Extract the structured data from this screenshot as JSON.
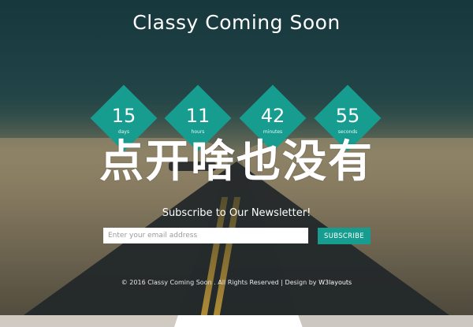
{
  "page": {
    "title": "Classy Coming Soon"
  },
  "countdown": [
    {
      "value": "15",
      "label": "days"
    },
    {
      "value": "11",
      "label": "hours"
    },
    {
      "value": "42",
      "label": "minutes"
    },
    {
      "value": "55",
      "label": "seconds"
    }
  ],
  "overlay": {
    "text": "点开啥也没有"
  },
  "newsletter": {
    "title": "Subscribe to Our Newsletter!",
    "placeholder": "Enter your email address",
    "button_label": "SUBSCRIBE"
  },
  "footer": {
    "copyright": "© 2016 Classy Coming Soon . All Rights Reserved | Design by",
    "designer_link": "W3layouts"
  },
  "colors": {
    "accent": "#179d8f"
  }
}
